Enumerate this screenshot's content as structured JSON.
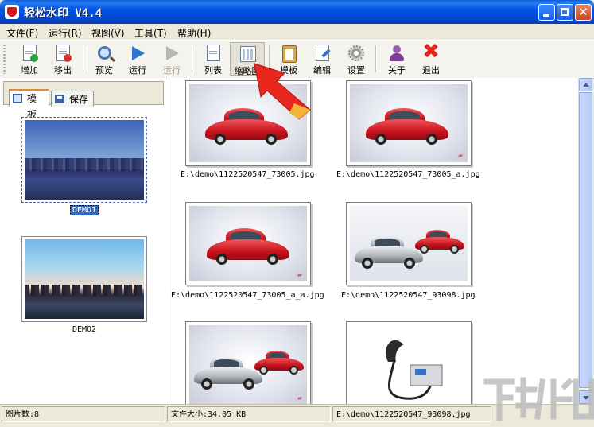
{
  "window": {
    "title": "轻松水印 V4.4"
  },
  "menu": [
    "文件(F)",
    "运行(R)",
    "视图(V)",
    "工具(T)",
    "帮助(H)"
  ],
  "toolbar": {
    "add": "增加",
    "remove": "移出",
    "preview": "预览",
    "run": "运行",
    "run_disabled": "运行",
    "list": "列表",
    "thumbnail": "缩略图",
    "template": "模板",
    "edit": "编辑",
    "settings": "设置",
    "about": "关于",
    "exit": "退出"
  },
  "left_panel": {
    "tabs": {
      "template": "模板",
      "save": "保存"
    },
    "items": [
      {
        "name": "DEMO1",
        "selected": true
      },
      {
        "name": "DEMO2",
        "selected": false
      }
    ]
  },
  "gallery": {
    "files": [
      "E:\\demo\\1122520547_73005.jpg",
      "E:\\demo\\1122520547_73005_a.jpg",
      "E:\\demo\\1122520547_73005_a_a.jpg",
      "E:\\demo\\1122520547_93098.jpg"
    ]
  },
  "status": {
    "count": "图片数:8",
    "size": "文件大小:34.05 KB",
    "path": "E:\\demo\\1122520547_93098.jpg"
  }
}
